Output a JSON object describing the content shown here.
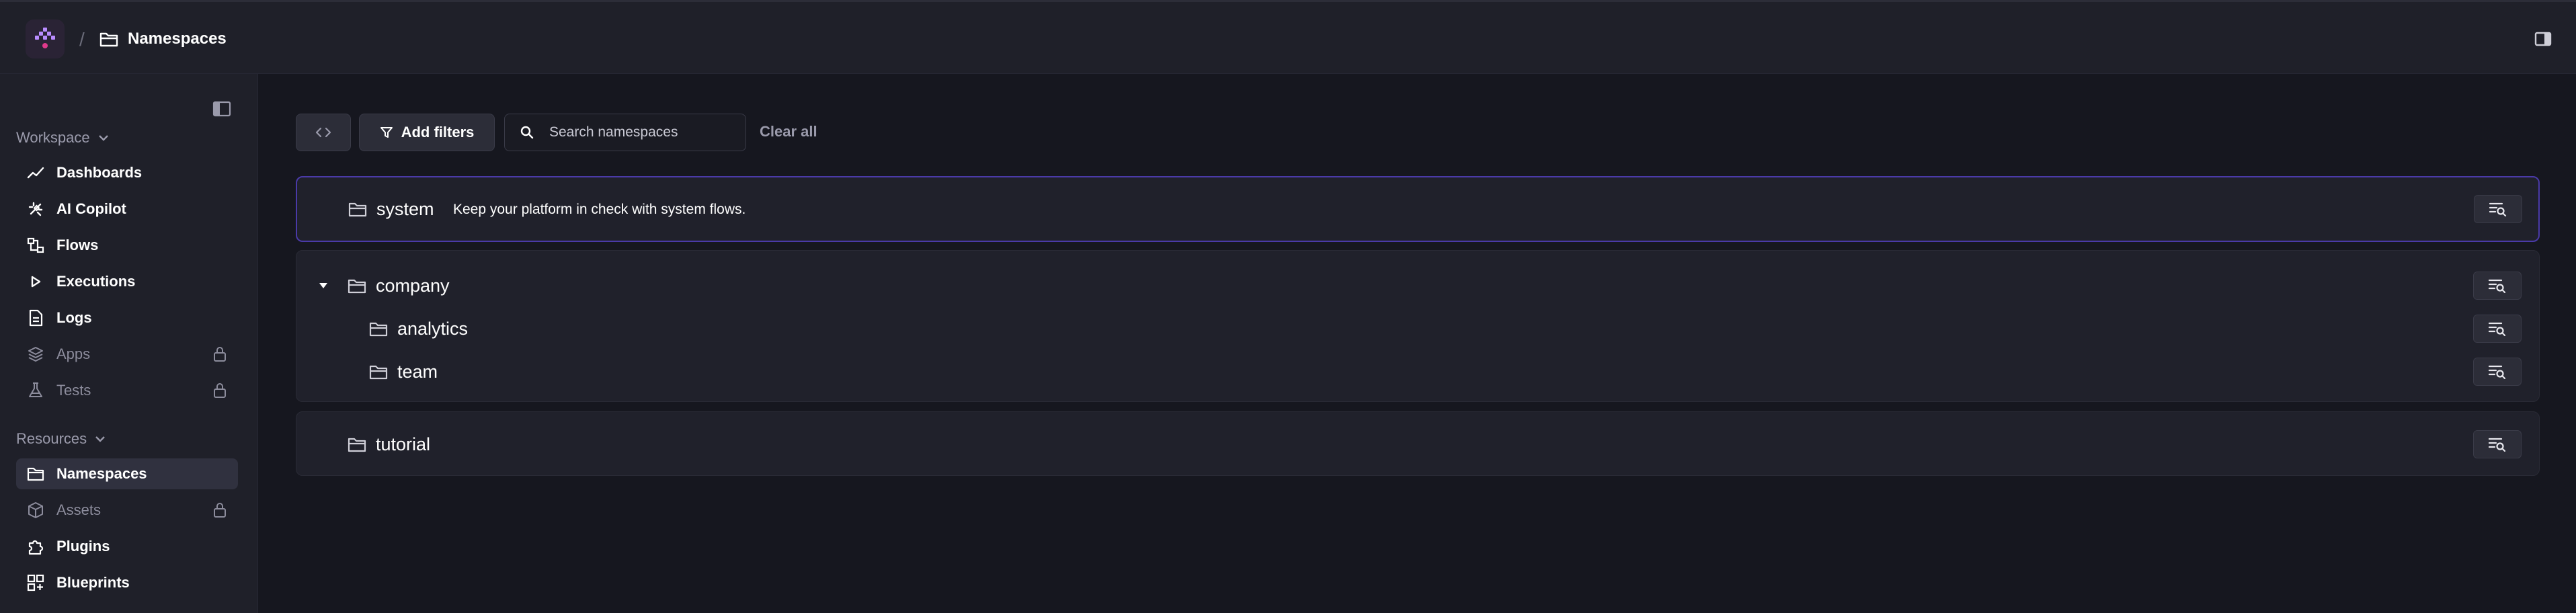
{
  "header": {
    "breadcrumb_separator": "/",
    "breadcrumb_title": "Namespaces",
    "logo_icon": "kestra-logo-icon",
    "panel_icon": "panel-toggle-icon"
  },
  "sidebar": {
    "workspace_label": "Workspace",
    "resources_label": "Resources",
    "workspace_items": [
      {
        "label": "Dashboards",
        "icon": "chart-line-icon",
        "locked": false
      },
      {
        "label": "AI Copilot",
        "icon": "sparkle-icon",
        "locked": false
      },
      {
        "label": "Flows",
        "icon": "flows-icon",
        "locked": false
      },
      {
        "label": "Executions",
        "icon": "play-icon",
        "locked": false
      },
      {
        "label": "Logs",
        "icon": "file-icon",
        "locked": false
      },
      {
        "label": "Apps",
        "icon": "layers-icon",
        "locked": true
      },
      {
        "label": "Tests",
        "icon": "flask-icon",
        "locked": true
      }
    ],
    "resources_items": [
      {
        "label": "Namespaces",
        "icon": "folder-icon",
        "locked": false,
        "active": true
      },
      {
        "label": "Assets",
        "icon": "cube-icon",
        "locked": true
      },
      {
        "label": "Plugins",
        "icon": "puzzle-icon",
        "locked": false
      },
      {
        "label": "Blueprints",
        "icon": "blueprint-icon",
        "locked": false
      }
    ]
  },
  "toolbar": {
    "add_filters_label": "Add filters",
    "search_placeholder": "Search namespaces",
    "clear_all_label": "Clear all"
  },
  "namespaces": {
    "system": {
      "name": "system",
      "description": "Keep your platform in check with system flows."
    },
    "company": {
      "name": "company",
      "children": [
        "analytics",
        "team"
      ]
    },
    "tutorial": {
      "name": "tutorial"
    }
  },
  "colors": {
    "accent": "#7c5cff",
    "highlight_border": "#4a3aa8",
    "background": "#16171f",
    "panel": "#1f2029"
  }
}
